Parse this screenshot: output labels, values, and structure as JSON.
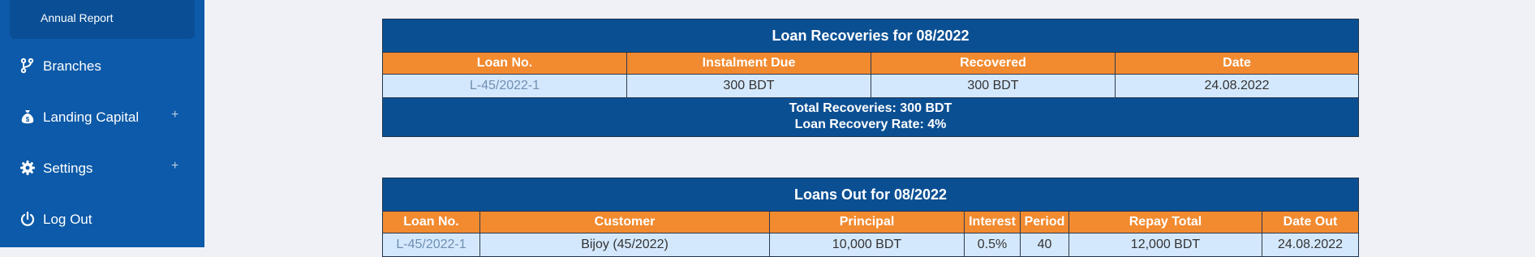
{
  "sidebar": {
    "sub_item": "Annual Report",
    "items": [
      {
        "label": "Branches",
        "icon": "branch-icon"
      },
      {
        "label": "Landing Capital",
        "icon": "money-bag-icon",
        "expand": "+"
      },
      {
        "label": "Settings",
        "icon": "gear-icon",
        "expand": "+"
      },
      {
        "label": "Log Out",
        "icon": "power-icon"
      }
    ]
  },
  "recoveries": {
    "title": "Loan Recoveries for 08/2022",
    "columns": [
      "Loan No.",
      "Instalment Due",
      "Recovered",
      "Date"
    ],
    "rows": [
      [
        "L-45/2022-1",
        "300 BDT",
        "300 BDT",
        "24.08.2022"
      ]
    ],
    "total": "Total Recoveries: 300 BDT",
    "rate": "Loan Recovery Rate: 4%"
  },
  "loans_out": {
    "title": "Loans Out for 08/2022",
    "columns": [
      "Loan No.",
      "Customer",
      "Principal",
      "Interest",
      "Period",
      "Repay Total",
      "Date Out"
    ],
    "rows": [
      [
        "L-45/2022-1",
        "Bijoy (45/2022)",
        "10,000 BDT",
        "0.5%",
        "40",
        "12,000 BDT",
        "24.08.2022"
      ]
    ]
  },
  "colors": {
    "sidebar": "#0c5aa9",
    "table_title": "#0b4f93",
    "table_header": "#f28a2f",
    "table_row": "#d4e8fd"
  }
}
